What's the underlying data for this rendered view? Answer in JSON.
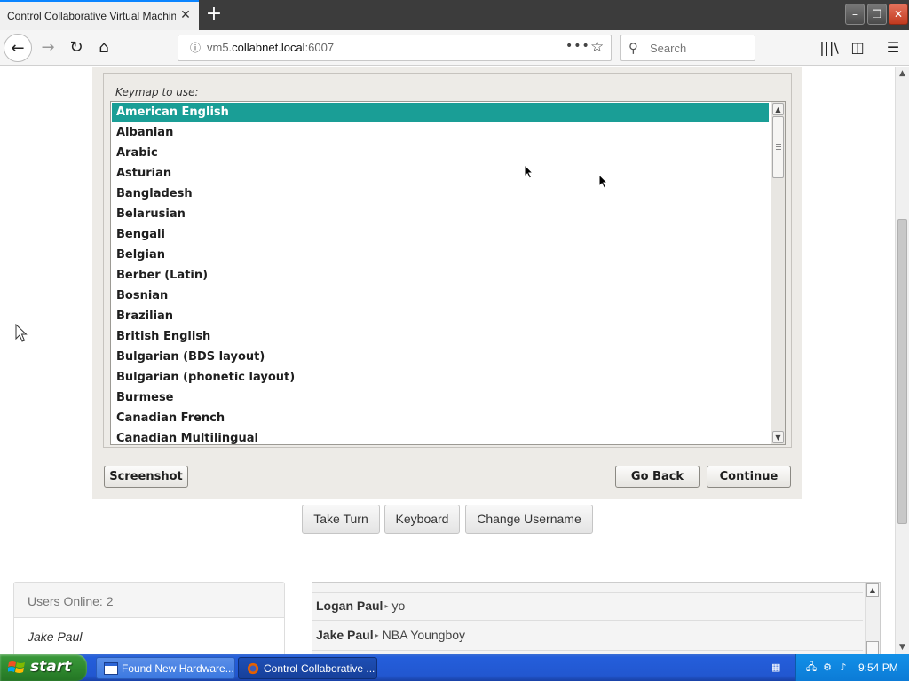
{
  "browser": {
    "tab_title": "Control Collaborative Virtual Machines!",
    "tab_close": "✕",
    "new_tab": "+",
    "url_host": "vm5.",
    "url_domain": "collabnet.local",
    "url_port": ":6007",
    "search_placeholder": "Search",
    "window_controls": {
      "minimize": "–",
      "maximize": "❐",
      "close": "✕"
    }
  },
  "installer": {
    "keymap_label": "Keymap to use:",
    "keymaps": [
      "American English",
      "Albanian",
      "Arabic",
      "Asturian",
      "Bangladesh",
      "Belarusian",
      "Bengali",
      "Belgian",
      "Berber (Latin)",
      "Bosnian",
      "Brazilian",
      "British English",
      "Bulgarian (BDS layout)",
      "Bulgarian (phonetic layout)",
      "Burmese",
      "Canadian French",
      "Canadian Multilingual"
    ],
    "selected_index": 0,
    "buttons": {
      "screenshot": "Screenshot",
      "go_back": "Go Back",
      "continue": "Continue"
    }
  },
  "controls": {
    "take_turn": "Take Turn",
    "keyboard": "Keyboard",
    "change_username": "Change Username"
  },
  "users": {
    "header": "Users Online: 2",
    "list": [
      "Jake Paul"
    ]
  },
  "chat": {
    "messages": [
      {
        "user": "Logan Paul",
        "text": "yo"
      },
      {
        "user": "Jake Paul",
        "text": "NBA Youngboy"
      }
    ]
  },
  "taskbar": {
    "start_label": "start",
    "tasks": [
      "Found New Hardware...",
      "Control Collaborative ..."
    ],
    "clock": "9:54 PM"
  },
  "colors": {
    "selection": "#1a9e96",
    "titlebar": "#3c3c3c",
    "taskbar": "#245edb",
    "start": "#2f8a2f"
  }
}
